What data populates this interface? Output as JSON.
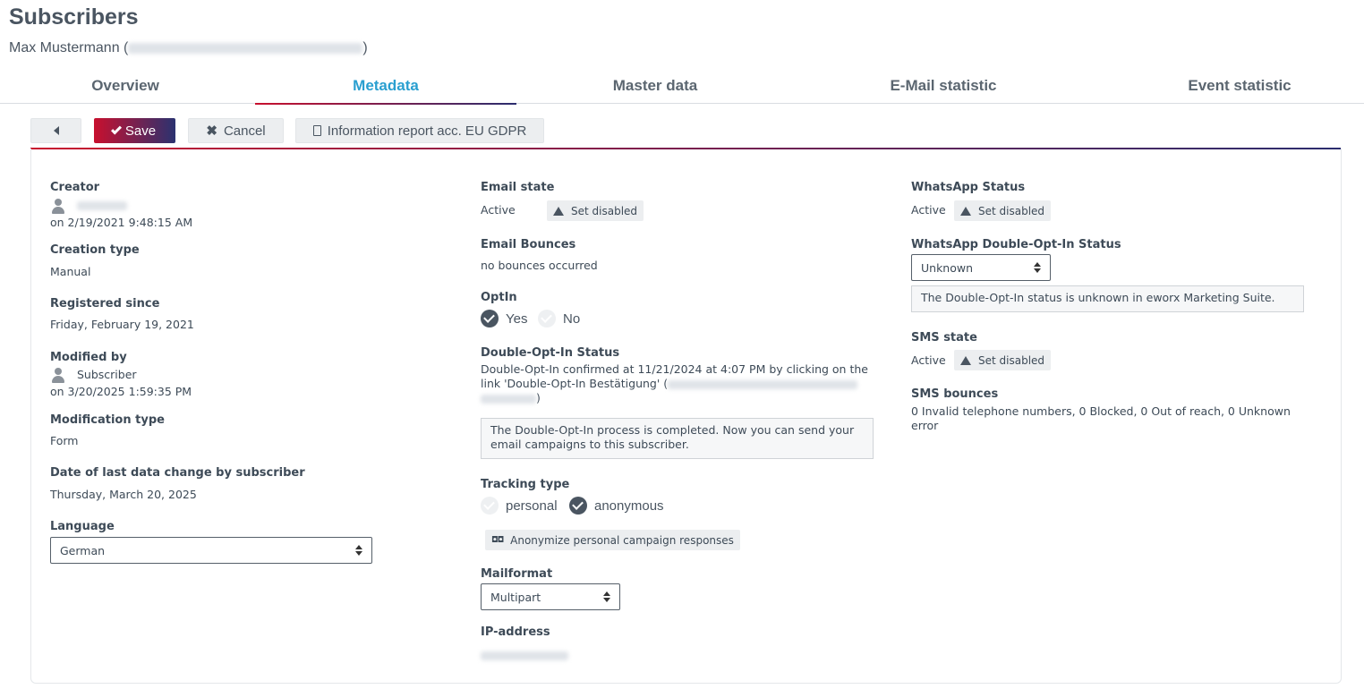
{
  "header": {
    "title": "Subscribers",
    "subscriber_name": "Max Mustermann",
    "open_paren": "(",
    "close_paren": ")"
  },
  "tabs": [
    {
      "label": "Overview"
    },
    {
      "label": "Metadata"
    },
    {
      "label": "Master data"
    },
    {
      "label": "E-Mail statistic"
    },
    {
      "label": "Event statistic"
    }
  ],
  "toolbar": {
    "back_icon": "caret-left-icon",
    "save_label": "Save",
    "cancel_label": "Cancel",
    "report_label": "Information report acc. EU GDPR"
  },
  "left": {
    "creator_label": "Creator",
    "creator_date": "on 2/19/2021 9:48:15 AM",
    "creation_type_label": "Creation type",
    "creation_type": "Manual",
    "registered_label": "Registered since",
    "registered": "Friday, February 19, 2021",
    "modified_by_label": "Modified by",
    "modified_by": "Subscriber",
    "modified_date": "on 3/20/2025 1:59:35 PM",
    "modification_type_label": "Modification type",
    "modification_type": "Form",
    "last_change_label": "Date of last data change by subscriber",
    "last_change": "Thursday, March 20, 2025",
    "language_label": "Language",
    "language": "German"
  },
  "middle": {
    "email_state_label": "Email state",
    "email_state": "Active",
    "set_disabled": "Set disabled",
    "bounces_label": "Email Bounces",
    "bounces": "no bounces occurred",
    "optin_label": "OptIn",
    "optin_yes": "Yes",
    "optin_no": "No",
    "doi_label": "Double-Opt-In Status",
    "doi_line1": "Double-Opt-In confirmed at 11/21/2024 at 4:07 PM by clicking on the",
    "doi_line2": "link 'Double-Opt-In Bestätigung' (",
    "doi_close": ")",
    "doi_info": "The Double-Opt-In process is completed. Now you can send your email campaigns to this subscriber.",
    "tracking_label": "Tracking type",
    "tracking_personal": "personal",
    "tracking_anonymous": "anonymous",
    "anonymize_label": "Anonymize personal campaign responses",
    "mailformat_label": "Mailformat",
    "mailformat": "Multipart",
    "ip_label": "IP-address"
  },
  "right": {
    "whatsapp_status_label": "WhatsApp Status",
    "whatsapp_status": "Active",
    "set_disabled": "Set disabled",
    "whatsapp_doi_label": "WhatsApp Double-Opt-In Status",
    "whatsapp_doi": "Unknown",
    "whatsapp_doi_info": "The Double-Opt-In status is unknown in eworx Marketing Suite.",
    "sms_state_label": "SMS state",
    "sms_state": "Active",
    "sms_set_disabled": "Set disabled",
    "sms_bounces_label": "SMS bounces",
    "sms_bounces_line1": "0 Invalid telephone numbers, 0 Blocked, 0 Out of reach, 0 Unknown",
    "sms_bounces_line2": "error"
  },
  "colors": {
    "accent": "#2a9fd0",
    "brand_red": "#c8102e",
    "brand_navy": "#2b2d6e",
    "text": "#3d4a57"
  }
}
